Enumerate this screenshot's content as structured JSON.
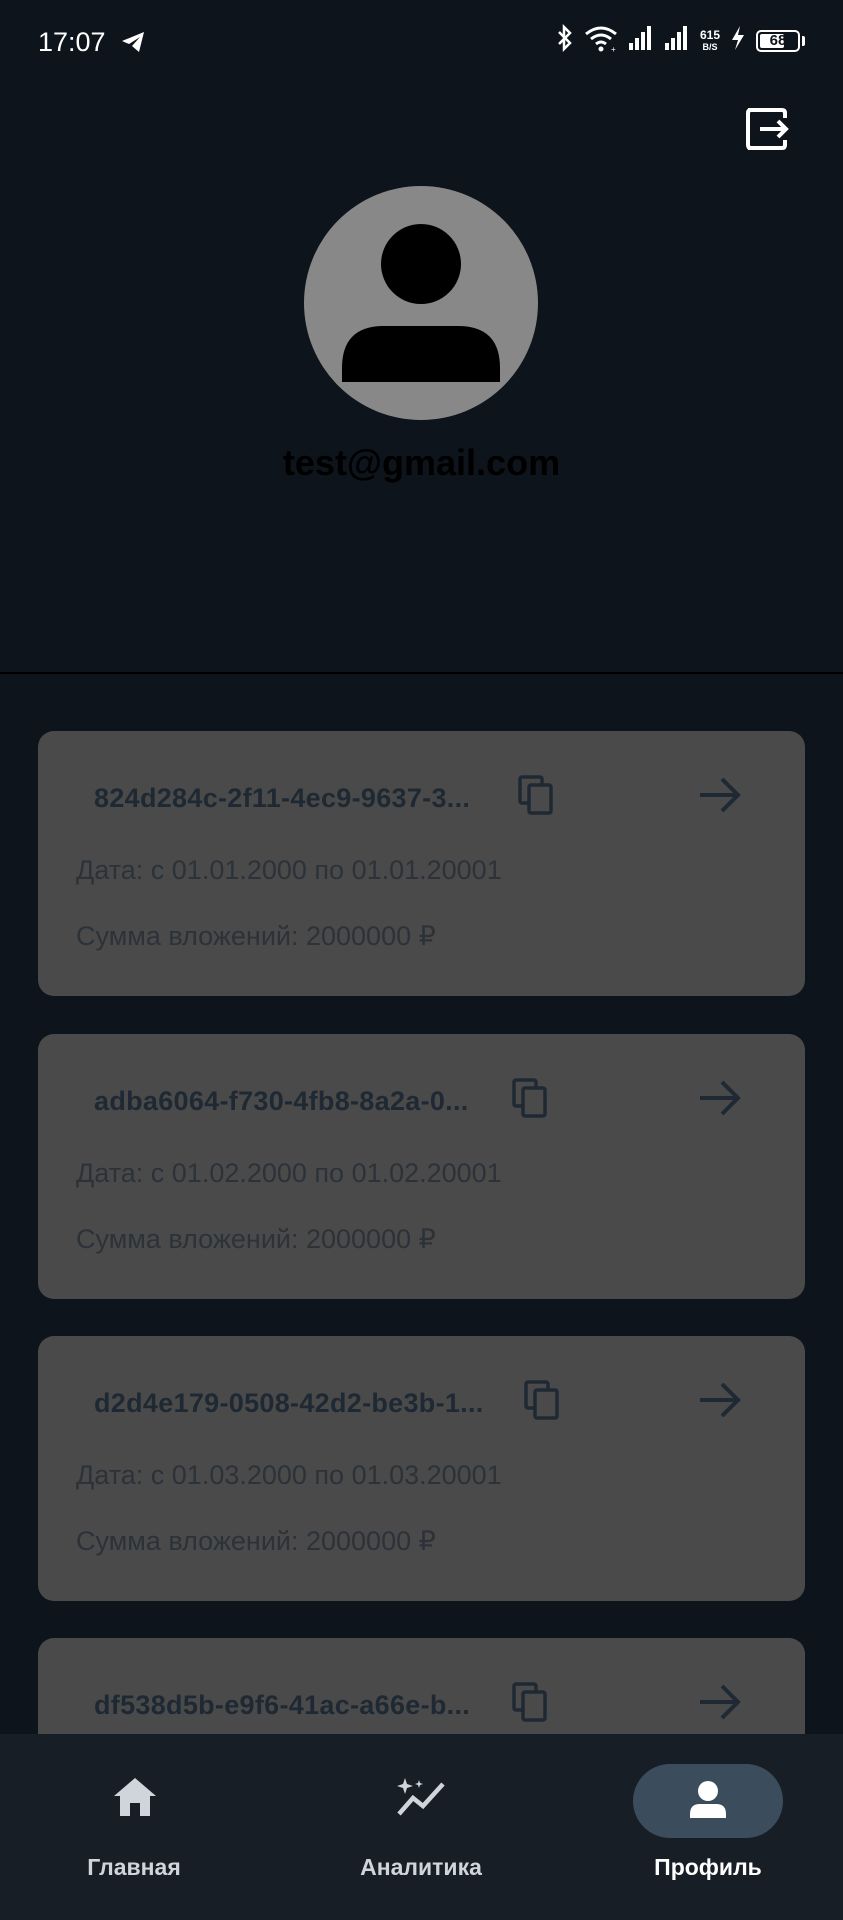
{
  "status_bar": {
    "time": "17:07",
    "net_speed_value": "615",
    "net_speed_unit": "B/S",
    "battery": "68",
    "battery_level": 0.68,
    "icons": [
      "telegram-icon",
      "bluetooth-icon",
      "wifi-icon",
      "signal-icon",
      "signal-icon",
      "charging-icon",
      "battery-icon"
    ]
  },
  "profile": {
    "email": "test@gmail.com",
    "logout_icon": "logout-icon",
    "avatar_icon": "person-icon"
  },
  "investments": [
    {
      "id": "824d284c-2f11-4ec9-9637-3...",
      "date": "Дата: с 01.01.2000 по 01.01.20001",
      "sum": "Сумма вложений: 2000000 ₽"
    },
    {
      "id": "adba6064-f730-4fb8-8a2a-0...",
      "date": "Дата: с 01.02.2000 по 01.02.20001",
      "sum": "Сумма вложений: 2000000 ₽"
    },
    {
      "id": "d2d4e179-0508-42d2-be3b-1...",
      "date": "Дата: с 01.03.2000 по 01.03.20001",
      "sum": "Сумма вложений: 2000000 ₽"
    },
    {
      "id": "df538d5b-e9f6-41ac-a66e-b...",
      "date": "",
      "sum": ""
    }
  ],
  "bottom_nav": {
    "items": [
      {
        "label": "Главная",
        "icon": "home-icon",
        "active": false
      },
      {
        "label": "Аналитика",
        "icon": "analytics-icon",
        "active": false
      },
      {
        "label": "Профиль",
        "icon": "profile-icon",
        "active": true
      }
    ]
  },
  "colors": {
    "background": "#0d141b",
    "card": "#4a4a4a",
    "nav_background": "#181e26",
    "nav_active_pill": "#3b4d5c",
    "avatar": "#888888"
  }
}
